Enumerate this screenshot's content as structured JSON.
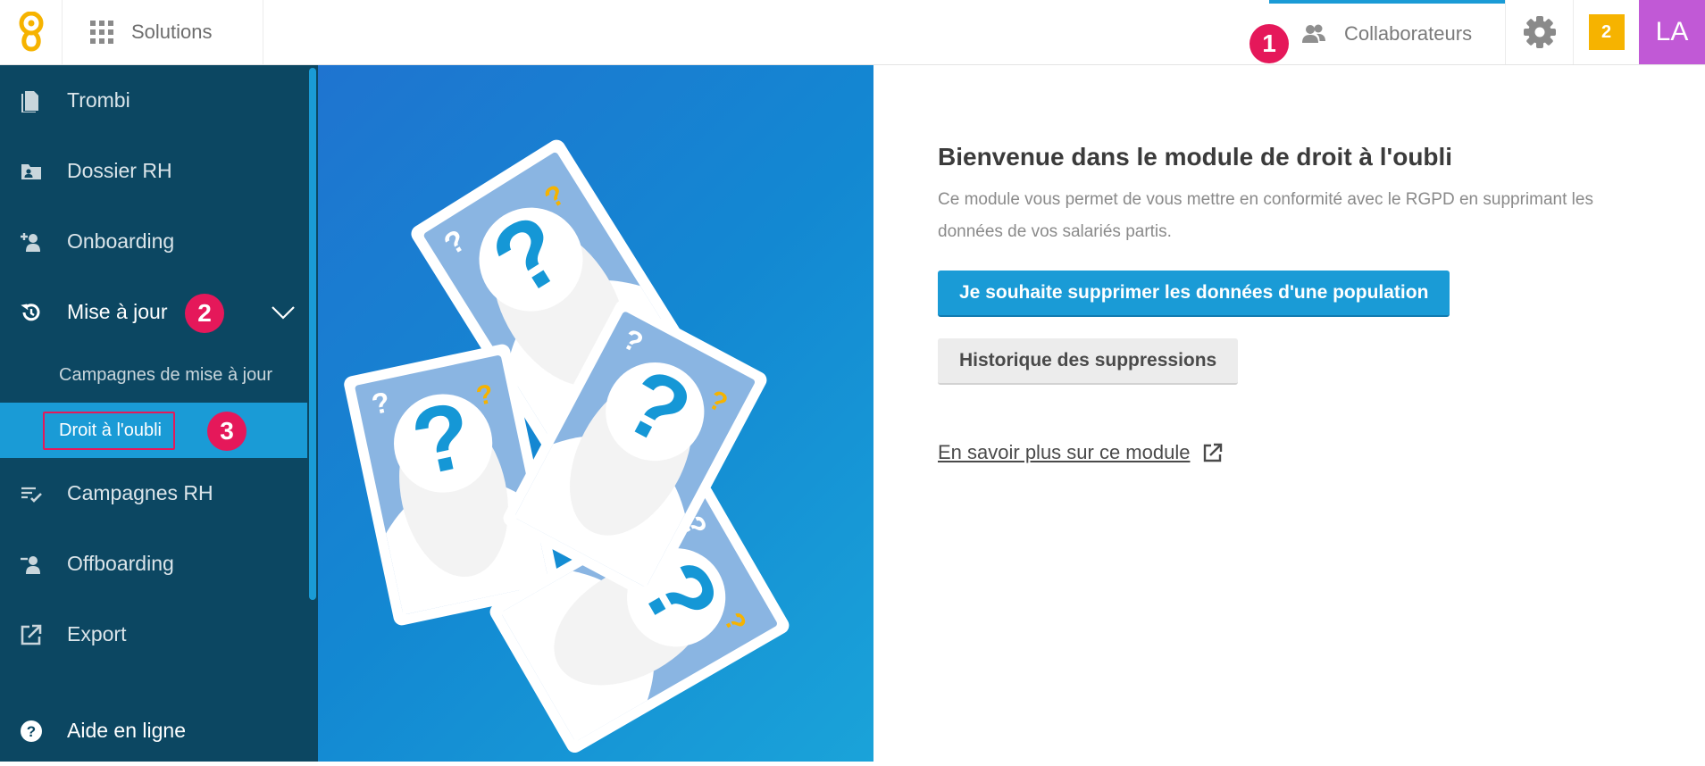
{
  "topbar": {
    "solutions_label": "Solutions",
    "collaborators_label": "Collaborateurs",
    "notification_count": "2",
    "avatar_initials": "LA",
    "accent_color": "#1a9bd6",
    "notification_color": "#f6b300",
    "avatar_color": "#c159d6"
  },
  "markers": {
    "m1": "1",
    "m2": "2",
    "m3": "3"
  },
  "sidebar": {
    "background": "#0c4762",
    "items": [
      {
        "label": "Trombi",
        "icon": "document-icon"
      },
      {
        "label": "Dossier RH",
        "icon": "folder-user-icon"
      },
      {
        "label": "Onboarding",
        "icon": "user-add-icon"
      },
      {
        "label": "Mise à jour",
        "icon": "refresh-icon",
        "expanded": true
      },
      {
        "label": "Campagnes RH",
        "icon": "list-check-icon"
      },
      {
        "label": "Offboarding",
        "icon": "user-remove-icon"
      },
      {
        "label": "Export",
        "icon": "export-icon"
      },
      {
        "label": "Aide en ligne",
        "icon": "help-icon"
      }
    ],
    "subitems": [
      {
        "label": "Campagnes de mise à jour"
      },
      {
        "label": "Droit à l'oubli",
        "selected": true
      }
    ]
  },
  "main": {
    "title": "Bienvenue dans le module de droit à l'oubli",
    "description": "Ce module vous permet de vous mettre en conformité avec le RGPD en supprimant les données de vos salariés partis.",
    "primary_button": "Je souhaite supprimer les données d'une population",
    "secondary_button": "Historique des suppressions",
    "learn_more": "En savoir plus sur ce module"
  }
}
